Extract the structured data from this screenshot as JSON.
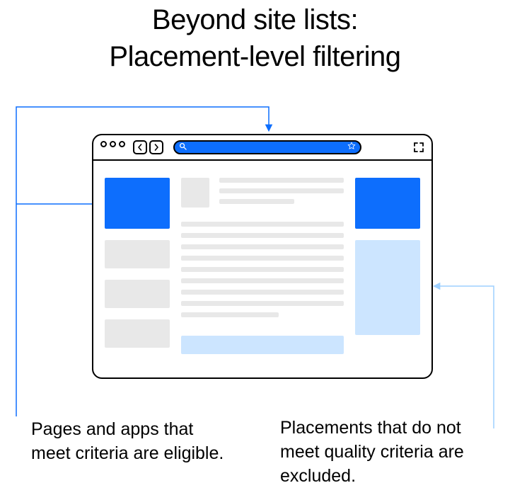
{
  "title_line1": "Beyond site lists:",
  "title_line2": "Placement-level filtering",
  "captions": {
    "eligible": "Pages and apps that meet criteria are eligible.",
    "excluded": "Placements that do not meet quality criteria are excluded."
  },
  "colors": {
    "accent": "#0d6efd",
    "accent_light": "#cce5ff",
    "connector_blue": "#0d6efd",
    "connector_light": "#9ed0ff"
  },
  "icons": {
    "back": "chevron-left-icon",
    "forward": "chevron-right-icon",
    "search": "search-icon",
    "star": "star-icon",
    "fullscreen": "fullscreen-icon"
  }
}
